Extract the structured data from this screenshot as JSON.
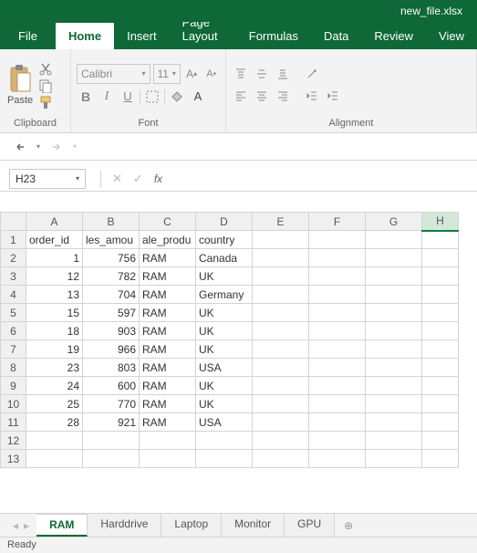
{
  "title": "new_file.xlsx",
  "menuTabs": {
    "file": "File",
    "home": "Home",
    "insert": "Insert",
    "pageLayout": "Page Layout",
    "formulas": "Formulas",
    "data": "Data",
    "review": "Review",
    "view": "View"
  },
  "ribbon": {
    "clipboard": {
      "paste": "Paste",
      "label": "Clipboard"
    },
    "font": {
      "name": "Calibri",
      "size": "11",
      "label": "Font"
    },
    "alignment": {
      "label": "Alignment"
    }
  },
  "nameBox": "H23",
  "fx": "fx",
  "columns": [
    "A",
    "B",
    "C",
    "D",
    "E",
    "F",
    "G",
    "H"
  ],
  "headers": {
    "A": "order_id",
    "B": "les_amou",
    "C": "ale_produ",
    "D": "country"
  },
  "rows": [
    {
      "n": 1,
      "A": "order_id",
      "B": "les_amou",
      "C": "ale_produ",
      "D": "country"
    },
    {
      "n": 2,
      "A": "1",
      "B": "756",
      "C": "RAM",
      "D": "Canada"
    },
    {
      "n": 3,
      "A": "12",
      "B": "782",
      "C": "RAM",
      "D": "UK"
    },
    {
      "n": 4,
      "A": "13",
      "B": "704",
      "C": "RAM",
      "D": "Germany"
    },
    {
      "n": 5,
      "A": "15",
      "B": "597",
      "C": "RAM",
      "D": "UK"
    },
    {
      "n": 6,
      "A": "18",
      "B": "903",
      "C": "RAM",
      "D": "UK"
    },
    {
      "n": 7,
      "A": "19",
      "B": "966",
      "C": "RAM",
      "D": "UK"
    },
    {
      "n": 8,
      "A": "23",
      "B": "803",
      "C": "RAM",
      "D": "USA"
    },
    {
      "n": 9,
      "A": "24",
      "B": "600",
      "C": "RAM",
      "D": "UK"
    },
    {
      "n": 10,
      "A": "25",
      "B": "770",
      "C": "RAM",
      "D": "UK"
    },
    {
      "n": 11,
      "A": "28",
      "B": "921",
      "C": "RAM",
      "D": "USA"
    },
    {
      "n": 12
    },
    {
      "n": 13
    }
  ],
  "sheets": [
    "RAM",
    "Harddrive",
    "Laptop",
    "Monitor",
    "GPU"
  ],
  "activeSheet": "RAM",
  "status": "Ready"
}
